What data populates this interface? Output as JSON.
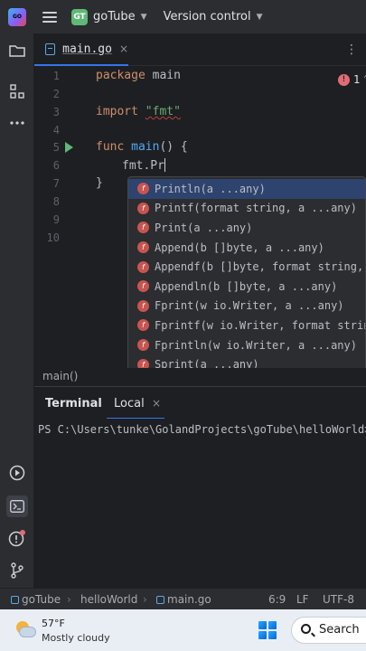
{
  "titlebar": {
    "project_badge": "GT",
    "project_name": "goTube",
    "vcs_label": "Version control"
  },
  "editor_tab": {
    "filename": "main.go",
    "close": "×"
  },
  "editor": {
    "error_count": "1",
    "line_numbers": [
      "1",
      "2",
      "3",
      "4",
      "5",
      "6",
      "7",
      "8",
      "9",
      "10"
    ],
    "lines": {
      "l1_kw": "package",
      "l1_rest": " main",
      "l3_kw": "import",
      "l3_str": "\"fmt\"",
      "l5_kw": "func",
      "l5_fn": "main",
      "l5_rest": "() {",
      "l6_text": "fmt.Pr",
      "l7_text": "}"
    }
  },
  "completion": {
    "icon_letter": "f",
    "items": [
      "Println(a ...any)",
      "Printf(format string, a ...any)",
      "Print(a ...any)",
      "Append(b []byte, a ...any)",
      "Appendf(b []byte, format string, a ...any)",
      "Appendln(b []byte, a ...any)",
      "Fprint(w io.Writer, a ...any)",
      "Fprintf(w io.Writer, format string, a ...any)",
      "Fprintln(w io.Writer, a ...any)",
      "Sprint(a ...any)"
    ]
  },
  "breadcrumb": "main()",
  "terminal": {
    "title": "Terminal",
    "tab_label": "Local",
    "tab_close": "×",
    "prompt": "PS C:\\Users\\tunke\\GolandProjects\\goTube\\helloWorld>"
  },
  "statusbar": {
    "project": "goTube",
    "folder": "helloWorld",
    "file": "main.go",
    "position": "6:9",
    "line_ending": "LF",
    "encoding": "UTF-8"
  },
  "taskbar": {
    "temperature": "57°F",
    "condition": "Mostly cloudy",
    "search_label": "Search"
  },
  "colors": {
    "accent": "#3574f0",
    "keyword": "#cf8e6d",
    "string": "#6aab73",
    "function": "#56a8f5",
    "error": "#e06c75"
  }
}
